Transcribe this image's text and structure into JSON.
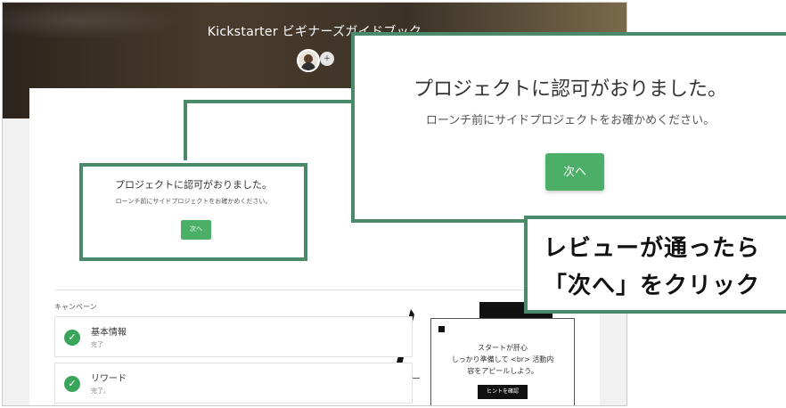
{
  "header": {
    "title": "Kickstarter ビギナーズガイドブック",
    "avatar_badge": "+"
  },
  "dialog_small": {
    "title": "プロジェクトに認可がおりました。",
    "subtitle": "ローンチ前にサイドプロジェクトをお確かめください。",
    "next_button": "次へ"
  },
  "dialog_large": {
    "title": "プロジェクトに認可がおりました。",
    "subtitle": "ローンチ前にサイドプロジェクトをお確かめください。",
    "next_button": "次へ"
  },
  "callout": {
    "line1": "レビューが通ったら",
    "line2": "「次へ」をクリック"
  },
  "campaign": {
    "label": "キャンペーン",
    "tasks": [
      {
        "title": "基本情報",
        "status": "完了"
      },
      {
        "title": "リワード",
        "status": "完了。"
      }
    ]
  },
  "hint_card": {
    "text_line1": "スタートが肝心",
    "text_line2": "しっかり準備して <br> 活動内",
    "text_line3": "容をアピールしよう。",
    "button": "ヒントを確認"
  },
  "icons": {
    "check": "check-icon",
    "avatar": "avatar-icon"
  },
  "colors": {
    "accent_green": "#4caf67",
    "frame_green": "#4a8a6a"
  }
}
